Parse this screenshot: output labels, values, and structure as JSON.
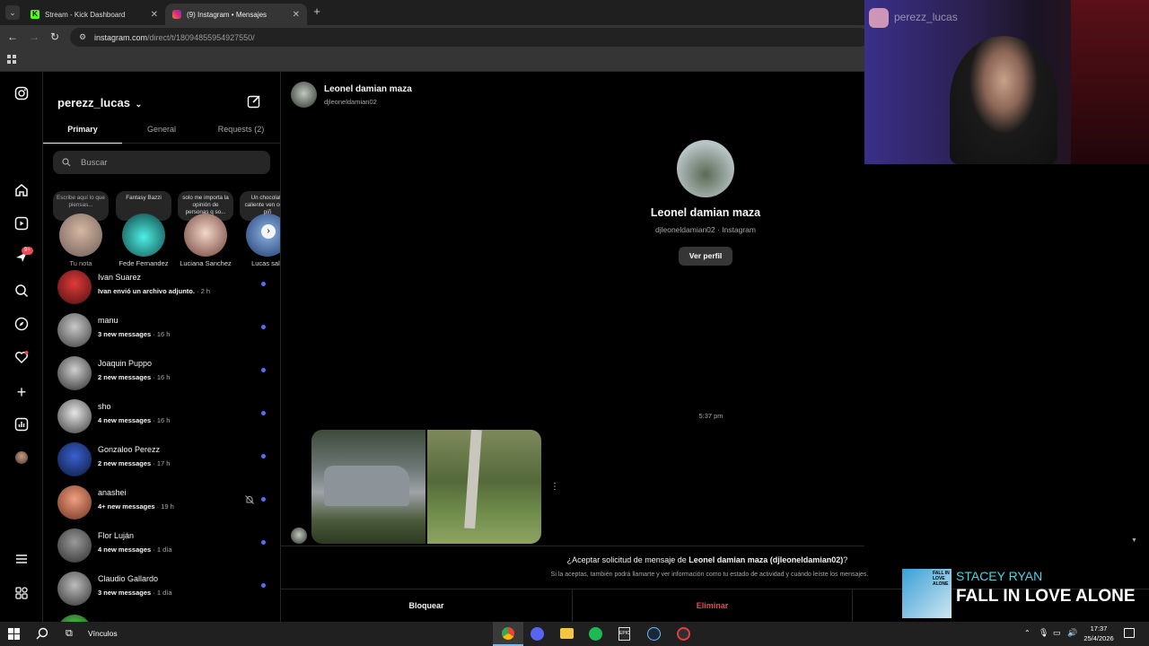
{
  "browser": {
    "tabs": [
      {
        "label": "Stream - Kick Dashboard",
        "active": false
      },
      {
        "label": "(9) Instagram • Mensajes",
        "active": true
      }
    ],
    "url_domain": "instagram.com",
    "url_path": "/direct/t/18094855954927550/"
  },
  "sidebar": {
    "username": "perezz_lucas",
    "tabs": [
      {
        "label": "Primary",
        "active": true
      },
      {
        "label": "General",
        "active": false
      },
      {
        "label": "Requests (2)",
        "active": false
      }
    ],
    "search_placeholder": "Buscar",
    "notifications_badge": "9+",
    "notes": [
      {
        "text": "Escribe aquí lo que piensas...",
        "name": "Tu nota"
      },
      {
        "text": "Fantasy Bazzi",
        "name": "Fede Fernandez"
      },
      {
        "text": "solo me importa la opinión de personas q so...",
        "name": "Luciana Sanchez"
      },
      {
        "text": "Un chocolate caliente ven como piñ",
        "name": "Lucas sala"
      }
    ],
    "chats": [
      {
        "name": "Ivan Suarez",
        "preview": "Ivan envió un archivo adjunto.",
        "time": " · 2 h"
      },
      {
        "name": "manu",
        "preview": "3 new messages",
        "time": " · 16 h"
      },
      {
        "name": "Joaquin Puppo",
        "preview": "2 new messages",
        "time": " · 16 h"
      },
      {
        "name": "sho",
        "preview": "4 new messages",
        "time": " · 16 h"
      },
      {
        "name": "Gonzaloo Perezz",
        "preview": "2 new messages",
        "time": " · 17 h"
      },
      {
        "name": "anashei",
        "preview": "4+ new messages",
        "time": " · 19 h"
      },
      {
        "name": "Flor Luján",
        "preview": "4 new messages",
        "time": " · 1 día"
      },
      {
        "name": "Claudio Gallardo",
        "preview": "3 new messages",
        "time": " · 1 día"
      }
    ]
  },
  "conversation": {
    "header_name": "Leonel damian maza",
    "header_handle": "djleoneldamian02",
    "profile_name": "Leonel damian maza",
    "profile_sub": "djleoneldamian02 · Instagram",
    "view_profile": "Ver perfil",
    "timestamp": "5:37 pm",
    "request_prefix": "¿Aceptar solicitud de mensaje de ",
    "request_name": "Leonel damian maza (djleoneldamian02)",
    "request_suffix": "?",
    "request_note": "Si la aceptas, también podrá llamarte y ver información como tu estado de actividad y cuándo leíste los mensajes.",
    "block": "Bloquear",
    "delete": "Eliminar"
  },
  "overlay": {
    "cam_user": "perezz_lucas",
    "music_artist": "STACEY RYAN",
    "music_title": "FALL IN LOVE ALONE",
    "album_text": "FALL IN LOVE ALONE"
  },
  "taskbar": {
    "search_label": "Vínculos",
    "time": "17:37",
    "date": "25/4/2026"
  },
  "colors": {
    "accent_blue": "#5a6bff",
    "danger_red": "#ed4956",
    "kick_green": "#53fc18"
  }
}
